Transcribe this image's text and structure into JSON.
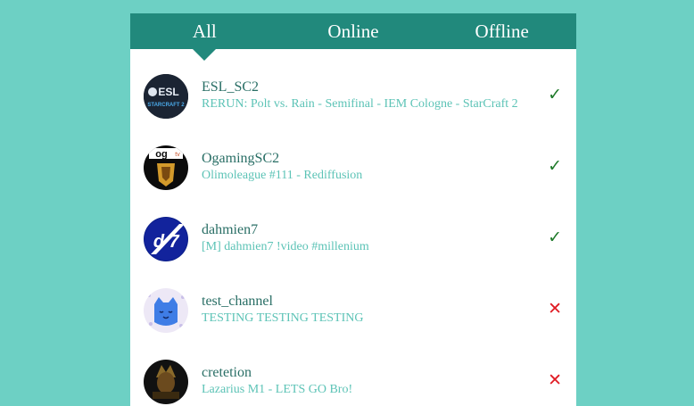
{
  "tabs": [
    {
      "label": "All",
      "active": true
    },
    {
      "label": "Online",
      "active": false
    },
    {
      "label": "Offline",
      "active": false
    }
  ],
  "channels": [
    {
      "name": "ESL_SC2",
      "status": "RERUN: Polt vs. Rain - Semifinal - IEM Cologne - StarCraft 2",
      "online": true,
      "indicator": "✓",
      "avatar_icon": "esl-starcraft2-logo",
      "avatar_text": "ESL",
      "avatar_subtext": "STARCRAFT 2"
    },
    {
      "name": "OgamingSC2",
      "status": "Olimoleague #111 - Rediffusion",
      "online": true,
      "indicator": "✓",
      "avatar_icon": "ogaming-logo",
      "avatar_text": "og tv"
    },
    {
      "name": "dahmien7",
      "status": "[M] dahmien7 !video #millenium",
      "online": true,
      "indicator": "✓",
      "avatar_icon": "d7-logo",
      "avatar_text": "d7"
    },
    {
      "name": "test_channel",
      "status": "TESTING TESTING TESTING",
      "online": false,
      "indicator": "✕",
      "avatar_icon": "blue-monster-avatar"
    },
    {
      "name": "cretetion",
      "status": "Lazarius M1 - LETS GO Bro!",
      "online": false,
      "indicator": "✕",
      "avatar_icon": "cretetion-avatar"
    }
  ],
  "colors": {
    "background": "#6dd0c4",
    "tab_bar": "#21897c",
    "name_text": "#2a6f66",
    "status_text": "#5cc3b6",
    "online": "#1f7a2a",
    "offline": "#e01c24"
  }
}
